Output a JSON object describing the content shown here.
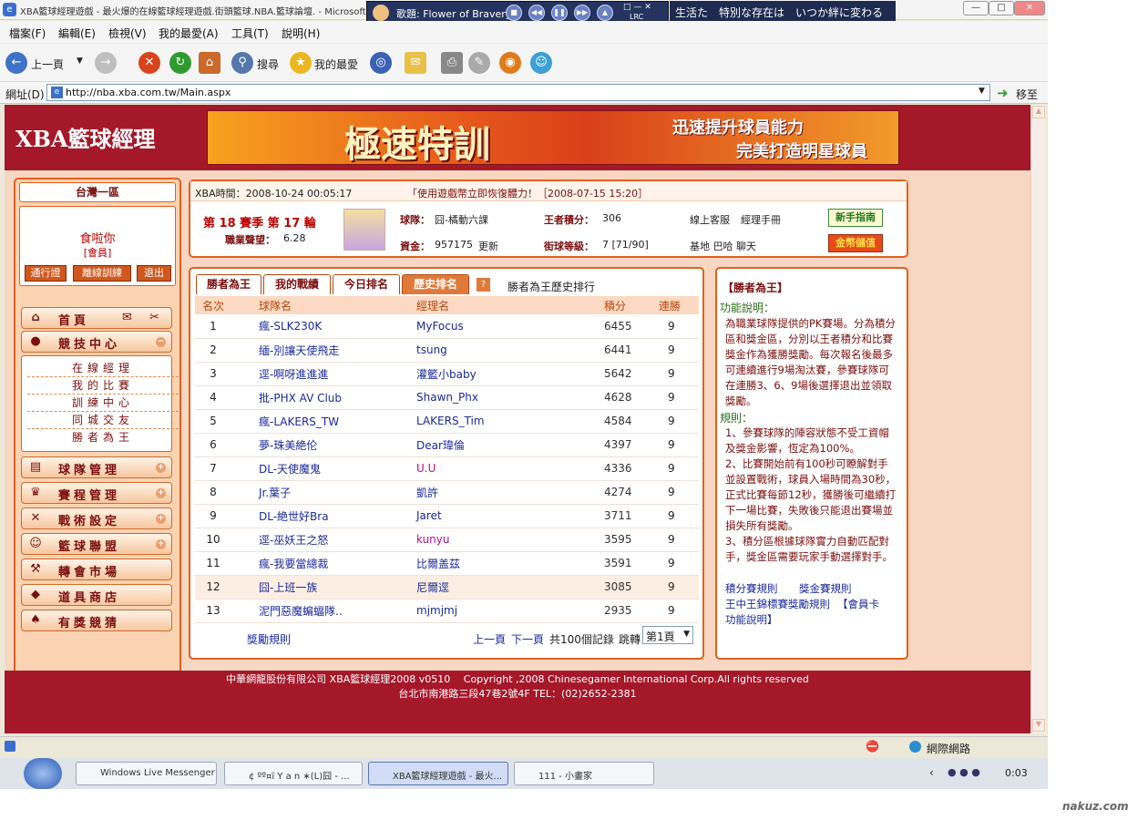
{
  "window": {
    "title": "XBA籃球經理遊戲 - 最火爆的在線籃球經理遊戲.街頭籃球.NBA.籃球論壇. - Microsoft Internet Explorer"
  },
  "player": {
    "title": "歌題: Flower of Bravery",
    "lrc": "LRC",
    "lyric": "生活た　特別な存在は　いつか絆に変わる"
  },
  "menu": [
    "檔案(F)",
    "編輯(E)",
    "檢視(V)",
    "我的最愛(A)",
    "工具(T)",
    "說明(H)"
  ],
  "toolbar": {
    "back": "上一頁",
    "search": "搜尋",
    "favorites": "我的最愛"
  },
  "address": {
    "label": "網址(D)",
    "url": "http://nba.xba.com.tw/Main.aspx",
    "go": "移至"
  },
  "header": {
    "logo": "XBA籃球經理",
    "banner_title": "極速特訓",
    "banner_line1": "迅速提升球員能力",
    "banner_line2": "完美打造明星球員"
  },
  "user": {
    "server": "台灣一區",
    "name": "食啦你",
    "role": "[會員]",
    "btn_pass": "通行證",
    "btn_offline": "離線訓練",
    "btn_logout": "退出"
  },
  "nav": {
    "home": "首頁",
    "competition": "競技中心",
    "sub": [
      "在線經理",
      "我的比賽",
      "訓練中心",
      "同城交友",
      "勝者為王"
    ],
    "team": "球隊管理",
    "schedule": "賽程管理",
    "tactics": "戰術設定",
    "league": "籃球聯盟",
    "transfer": "轉會市場",
    "shop": "道具商店",
    "prize": "有獎競猜"
  },
  "info": {
    "time": "XBA時間：2008-10-24 00:05:17",
    "notice": "「使用遊戲幣立即恢復體力！［2008-07-15 15:20］",
    "season": "第 18 賽季 第 17 輪",
    "career_label": "職業聲望：",
    "career": "6.28",
    "team_label": "球隊：",
    "team": "囧-橘動六課",
    "king_label": "王者積分：",
    "king": "306",
    "service": "線上客服",
    "manual": "經理手冊",
    "newbie": "新手指南",
    "money_label": "資金：",
    "money": "957175",
    "update": "更新",
    "level_label": "街球等級：",
    "level": "7 [71/90]",
    "links": "基地 巴哈 聊天",
    "recharge": "金幣儲值"
  },
  "rank": {
    "tabs": [
      "勝者為王",
      "我的戰績",
      "今日排名",
      "歷史排名"
    ],
    "help": "?",
    "caption": "勝者為王歷史排行",
    "columns": [
      "名次",
      "球隊名",
      "經理名",
      "積分",
      "連勝"
    ],
    "rows": [
      [
        "1",
        "瘋-SLK230K",
        "MyFocus",
        "6455",
        "9"
      ],
      [
        "2",
        "緬-別讓天使飛走",
        "tsung",
        "6441",
        "9"
      ],
      [
        "3",
        "逕-啊呀進進進",
        "灌籃小baby",
        "5642",
        "9"
      ],
      [
        "4",
        "批-PHX AV Club",
        "Shawn_Phx",
        "4628",
        "9"
      ],
      [
        "5",
        "瘋-LAKERS_TW",
        "LAKERS_Tim",
        "4584",
        "9"
      ],
      [
        "6",
        "夢-珠美絶伦",
        "Dear瑋倫",
        "4397",
        "9"
      ],
      [
        "7",
        "DL-天使魔鬼",
        "U.U",
        "4336",
        "9"
      ],
      [
        "8",
        "Jr.葉子",
        "凱許",
        "4274",
        "9"
      ],
      [
        "9",
        "DL-絶世好Bra",
        "Jaret",
        "3711",
        "9"
      ],
      [
        "10",
        "逕-巫妖王之怒",
        "kunyu",
        "3595",
        "9"
      ],
      [
        "11",
        "瘋-我要當總裁",
        "比爾盖茲",
        "3591",
        "9"
      ],
      [
        "12",
        "囧-上班一族",
        "尼爾逕",
        "3085",
        "9"
      ],
      [
        "13",
        "泥門惡魔蝙蝠隊..",
        "mjmjmj",
        "2935",
        "9"
      ]
    ],
    "rules_link": "獎勵規則",
    "prev": "上一頁",
    "next": "下一頁",
    "total": "共100個記錄",
    "jump": "跳轉",
    "page": "第1頁"
  },
  "rules": {
    "title": "【勝者為王】",
    "func_label": "功能說明：",
    "func": "為職業球隊提供的PK賽場。分為積分區和獎金區，分別以王者積分和比賽獎金作為獲勝獎勵。每次報名後最多可連續進行9場淘汰賽，參賽球隊可在連勝3、6、9場後選擇退出並領取獎勵。",
    "rule_label": "規則：",
    "r1": "1、參賽球隊的陣容狀態不受工資帽及獎金影響，恆定為100%。",
    "r2": "2、比賽開始前有100秒可瞭解對手並設置戰術，球員入場時間為30秒，正式比賽每節12秒，獲勝後可繼續打下一場比賽，失敗後只能退出賽場並損失所有獎勵。",
    "r3": "3、積分區根據球隊實力自動匹配對手，獎金區需要玩家手動選擇對手。",
    "l1": "積分賽規則",
    "l2": "獎金賽規則",
    "l3": "王中王錦標賽獎勵規則",
    "l4": "【會員卡功能說明】"
  },
  "footer": {
    "line1": "中華網龍股份有限公司 XBA籃球經理2008 v0510 　Copyright ,2008 Chinesegamer International Corp.All rights reserved",
    "line2": "台北市南港路三段47巷2號4F TEL：(02)2652-2381"
  },
  "status": {
    "zone": "網際網路"
  },
  "taskbar": {
    "items": [
      "Windows Live Messenger",
      "¢ ºº¤ï Y a n ∗(L)囧 - ...",
      "XBA籃球經理遊戲 - 最火...",
      "111 - 小畫家"
    ],
    "clock": "0:03"
  },
  "watermark": "nakuz.com"
}
